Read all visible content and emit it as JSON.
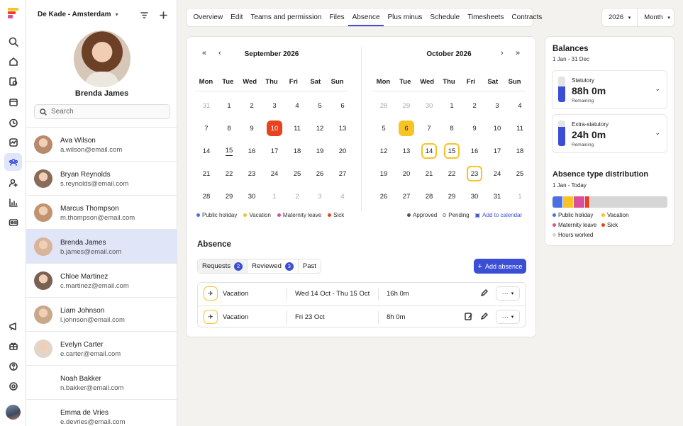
{
  "app": {
    "org_name": "De Kade - Amsterdam",
    "tabs": [
      "Overview",
      "Edit",
      "Teams and permission",
      "Files",
      "Absence",
      "Plus minus",
      "Schedule",
      "Timesheets",
      "Contracts"
    ],
    "active_tab": "Absence",
    "year": "2026",
    "view": "Month"
  },
  "profile": {
    "name": "Brenda James"
  },
  "search": {
    "placeholder": "Search"
  },
  "employees": [
    {
      "name": "Ava Wilson",
      "email": "a.wilson@email.com"
    },
    {
      "name": "Bryan Reynolds",
      "email": "s.reynolds@email.com"
    },
    {
      "name": "Marcus Thompson",
      "email": "m.thompson@email.com"
    },
    {
      "name": "Brenda James",
      "email": "b.james@email.com"
    },
    {
      "name": "Chloe Martinez",
      "email": "c.martinez@email.com"
    },
    {
      "name": "Liam Johnson",
      "email": "l.johnson@email.com"
    },
    {
      "name": "Evelyn Carter",
      "email": "e.carter@email.com"
    },
    {
      "name": "Noah Bakker",
      "email": "n.bakker@email.com"
    },
    {
      "name": "Emma de Vries",
      "email": "e.devries@email.com"
    }
  ],
  "calendar": {
    "weekdays": [
      "Mon",
      "Tue",
      "Wed",
      "Thu",
      "Fri",
      "Sat",
      "Sun"
    ],
    "months": [
      {
        "title": "September 2026",
        "days": [
          [
            "31",
            1
          ],
          [
            "1",
            0
          ],
          [
            "2",
            0
          ],
          [
            "3",
            0
          ],
          [
            "4",
            0
          ],
          [
            "5",
            0
          ],
          [
            "6",
            0
          ],
          [
            "7",
            0
          ],
          [
            "8",
            0
          ],
          [
            "9",
            0
          ],
          [
            "10",
            2
          ],
          [
            "11",
            0
          ],
          [
            "12",
            0
          ],
          [
            "13",
            0
          ],
          [
            "14",
            0
          ],
          [
            "15",
            5
          ],
          [
            "16",
            0
          ],
          [
            "17",
            0
          ],
          [
            "18",
            0
          ],
          [
            "19",
            0
          ],
          [
            "20",
            0
          ],
          [
            "21",
            0
          ],
          [
            "22",
            0
          ],
          [
            "23",
            0
          ],
          [
            "24",
            0
          ],
          [
            "25",
            0
          ],
          [
            "26",
            0
          ],
          [
            "27",
            0
          ],
          [
            "28",
            0
          ],
          [
            "29",
            0
          ],
          [
            "30",
            0
          ],
          [
            "1",
            1
          ],
          [
            "2",
            1
          ],
          [
            "3",
            1
          ],
          [
            "4",
            1
          ]
        ]
      },
      {
        "title": "October 2026",
        "days": [
          [
            "28",
            1
          ],
          [
            "29",
            1
          ],
          [
            "30",
            1
          ],
          [
            "1",
            0
          ],
          [
            "2",
            0
          ],
          [
            "3",
            0
          ],
          [
            "4",
            0
          ],
          [
            "5",
            0
          ],
          [
            "6",
            3
          ],
          [
            "7",
            0
          ],
          [
            "8",
            0
          ],
          [
            "9",
            0
          ],
          [
            "10",
            0
          ],
          [
            "11",
            0
          ],
          [
            "12",
            0
          ],
          [
            "13",
            0
          ],
          [
            "14",
            4
          ],
          [
            "15",
            4
          ],
          [
            "16",
            0
          ],
          [
            "17",
            0
          ],
          [
            "18",
            0
          ],
          [
            "19",
            0
          ],
          [
            "20",
            0
          ],
          [
            "21",
            0
          ],
          [
            "22",
            0
          ],
          [
            "23",
            4
          ],
          [
            "24",
            0
          ],
          [
            "25",
            0
          ],
          [
            "26",
            0
          ],
          [
            "27",
            0
          ],
          [
            "28",
            0
          ],
          [
            "29",
            0
          ],
          [
            "30",
            0
          ],
          [
            "31",
            0
          ],
          [
            "1",
            1
          ]
        ]
      }
    ],
    "legend_types": [
      {
        "label": "Public holiday",
        "color": "#4f6fe0"
      },
      {
        "label": "Vacation",
        "color": "#f7c325"
      },
      {
        "label": "Maternity leave",
        "color": "#d94f9c"
      },
      {
        "label": "Sick",
        "color": "#e8431f"
      }
    ],
    "legend_status": {
      "approved": "Approved",
      "pending": "Pending",
      "add_link": "Add to calendar"
    }
  },
  "absence": {
    "title": "Absence",
    "subtabs": [
      {
        "label": "Requests",
        "count": "2"
      },
      {
        "label": "Reviewed",
        "count": "3"
      },
      {
        "label": "Past",
        "count": ""
      }
    ],
    "add_label": "Add absence",
    "rows": [
      {
        "type": "Vacation",
        "dates": "Wed 14 Oct - Thu 15 Oct",
        "hours": "16h 0m"
      },
      {
        "type": "Vacation",
        "dates": "Fri 23 Oct",
        "hours": "8h 0m"
      }
    ]
  },
  "balances": {
    "title": "Balances",
    "period": "1 Jan - 31 Dec",
    "items": [
      {
        "label": "Statutory",
        "value": "88h 0m",
        "remaining_label": "Remaining",
        "fill_fraction": 0.6
      },
      {
        "label": "Extra-statutory",
        "value": "24h 0m",
        "remaining_label": "Remaining",
        "fill_fraction": 0.75
      }
    ],
    "distribution_title": "Absence type distribution",
    "distribution_period": "1 Jan - Today",
    "distribution": [
      {
        "label": "Public holiday",
        "color": "#4f6fe0",
        "fraction": 0.09
      },
      {
        "label": "Vacation",
        "color": "#f7c325",
        "fraction": 0.09
      },
      {
        "label": "Maternity leave",
        "color": "#d94f9c",
        "fraction": 0.09
      },
      {
        "label": "Sick",
        "color": "#e8431f",
        "fraction": 0.04
      },
      {
        "label": "Hours worked",
        "color": "#d6d6d6",
        "fraction": 0.69
      }
    ]
  },
  "colors": {
    "accent": "#3a4fd6",
    "today": "#e8431f",
    "vacation": "#f7c325"
  }
}
